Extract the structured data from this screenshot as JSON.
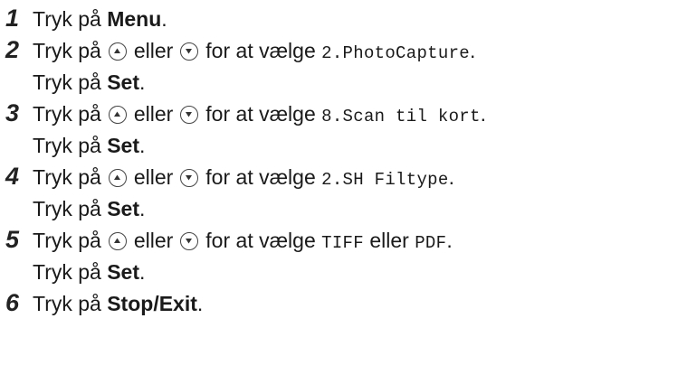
{
  "steps": [
    {
      "number": "1",
      "lines": [
        {
          "pre": "Tryk på ",
          "bold": "Menu",
          "post": "."
        }
      ]
    },
    {
      "number": "2",
      "lines": [
        {
          "pre": "Tryk på",
          "mid": "eller",
          "for": "for at vælge",
          "option": "2.PhotoCapture",
          "post": "."
        },
        {
          "pre": "Tryk på ",
          "bold": "Set",
          "post": "."
        }
      ]
    },
    {
      "number": "3",
      "lines": [
        {
          "pre": "Tryk på",
          "mid": "eller",
          "for": "for at vælge",
          "option": "8.Scan til kort",
          "post": "."
        },
        {
          "pre": "Tryk på ",
          "bold": "Set",
          "post": "."
        }
      ]
    },
    {
      "number": "4",
      "lines": [
        {
          "pre": "Tryk på",
          "mid": "eller",
          "for": "for at vælge",
          "option": "2.SH Filtype",
          "post": "."
        },
        {
          "pre": "Tryk på ",
          "bold": "Set",
          "post": "."
        }
      ]
    },
    {
      "number": "5",
      "lines": [
        {
          "pre": "Tryk på",
          "mid": "eller",
          "for": "for at vælge",
          "option_a": "TIFF",
          "or": "eller",
          "option_b": "PDF",
          "post": "."
        },
        {
          "pre": "Tryk på ",
          "bold": "Set",
          "post": "."
        }
      ]
    },
    {
      "number": "6",
      "lines": [
        {
          "pre": "Tryk på ",
          "bold": "Stop/Exit",
          "post": "."
        }
      ]
    }
  ],
  "icons": {
    "up": "up-arrow-button-icon",
    "down": "down-arrow-button-icon"
  }
}
